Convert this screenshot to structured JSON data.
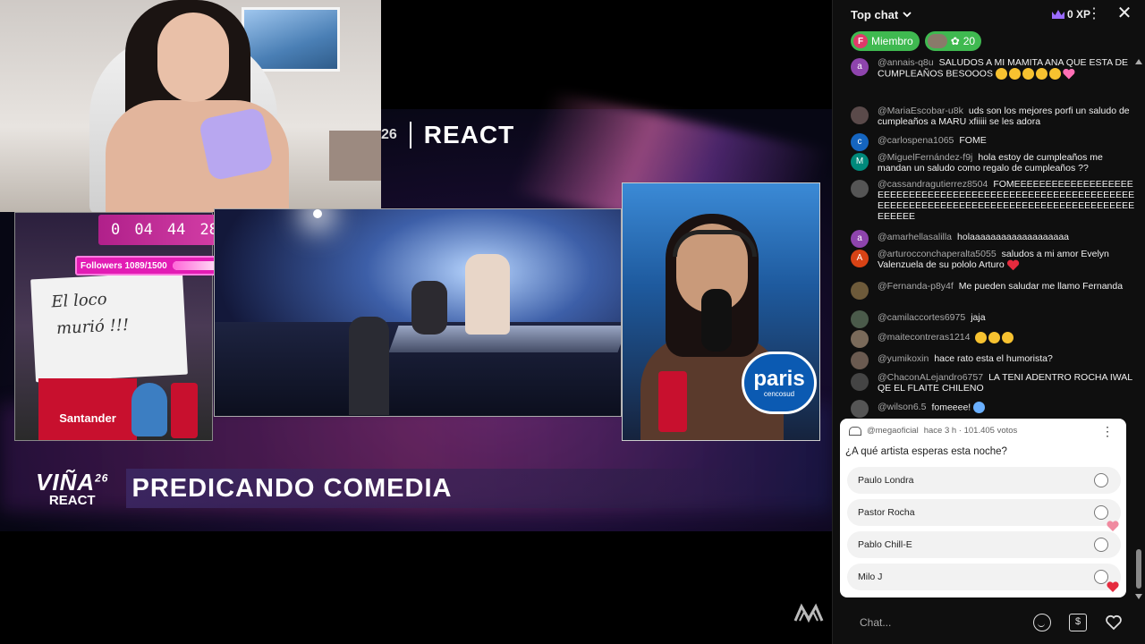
{
  "video": {
    "top_brand": {
      "num": "26",
      "react": "REACT"
    },
    "timer": {
      "h": "0",
      "m": "04",
      "s": "44",
      "f": "28"
    },
    "followers": {
      "label": "Followers 1089/1500",
      "current": 1089,
      "goal": 1500
    },
    "guest_board": {
      "line1": "El loco",
      "line2": "murió !!!"
    },
    "bank_label": "Santander",
    "paris": {
      "big": "paris",
      "small": "cencosud"
    },
    "lower_brand": {
      "v": "VIÑA",
      "sup": "26",
      "r": "REACT"
    },
    "lower_title": "PREDICANDO COMEDIA"
  },
  "chat": {
    "header": {
      "title": "Top chat",
      "xp": "0 XP"
    },
    "chips": {
      "member": "Miembro",
      "member_initial": "F",
      "gift_count": "20"
    },
    "messages": [
      {
        "author": "@annais-q8u",
        "text": "SALUDOS A MI MAMITA ANA QUE ESTA DE CUMPLEAÑOS BESOOOS",
        "avatar": "a",
        "color": "#8e44ad"
      },
      {
        "author": "@MariaEscobar-u8k",
        "text": "uds son los mejores porfi un saludo de cumpleaños a MARU xfiiiii se les adora",
        "avatar": "",
        "color": "#5a4a4a"
      },
      {
        "author": "@carlospena1065",
        "text": "FOME",
        "avatar": "c",
        "color": "#1565c0"
      },
      {
        "author": "@MiguelFernández-f9j",
        "text": "hola estoy de cumpleaños me mandan un saludo como regalo de cumpleaños ??",
        "avatar": "M",
        "color": "#00897b"
      },
      {
        "author": "@cassandragutierrez8504",
        "text": "FOMEEEEEEEEEEEEEEEEEEEEEEEEEEEEEEEEEEEEEEEEEEEEEEEEEEEEEEEEEEEEEEEEEEEEEEEEEEEEEEEEEEEEEEEEEEEEEEEEEEEEEEEEEEE",
        "avatar": "",
        "color": "#555"
      },
      {
        "author": "@amarhellasalilla",
        "text": "holaaaaaaaaaaaaaaaaaaa",
        "avatar": "a",
        "color": "#8e44ad"
      },
      {
        "author": "@arturocconchaperalta5055",
        "text": "saludos a mi amor Evelyn Valenzuela de su pololo Arturo",
        "avatar": "A",
        "color": "#d84315"
      },
      {
        "author": "@Fernanda-p8y4f",
        "text": "Me pueden saludar me llamo Fernanda",
        "avatar": "",
        "color": "#6d5a3a"
      },
      {
        "author": "@camilaccortes6975",
        "text": "jaja",
        "avatar": "",
        "color": "#4a5a4a"
      },
      {
        "author": "@maitecontreras1214",
        "text": "",
        "avatar": "",
        "color": "#7a6a5a"
      },
      {
        "author": "@yumikoxin",
        "text": "hace rato esta el humorista?",
        "avatar": "",
        "color": "#6a5a50"
      },
      {
        "author": "@ChaconALejandro6757",
        "text": "LA TENI ADENTRO ROCHA IWAL QE EL FLAITE CHILENO",
        "avatar": "",
        "color": "#444"
      },
      {
        "author": "@wilson6.5",
        "text": "fomeeee!",
        "avatar": "",
        "color": "#555"
      }
    ],
    "poll": {
      "channel": "@megaoficial",
      "meta": "hace 3 h · 101.405 votos",
      "question": "¿A qué artista esperas esta noche?",
      "options": [
        "Paulo Londra",
        "Pastor Rocha",
        "Pablo Chill-E",
        "Milo J"
      ]
    },
    "input_placeholder": "Chat..."
  }
}
